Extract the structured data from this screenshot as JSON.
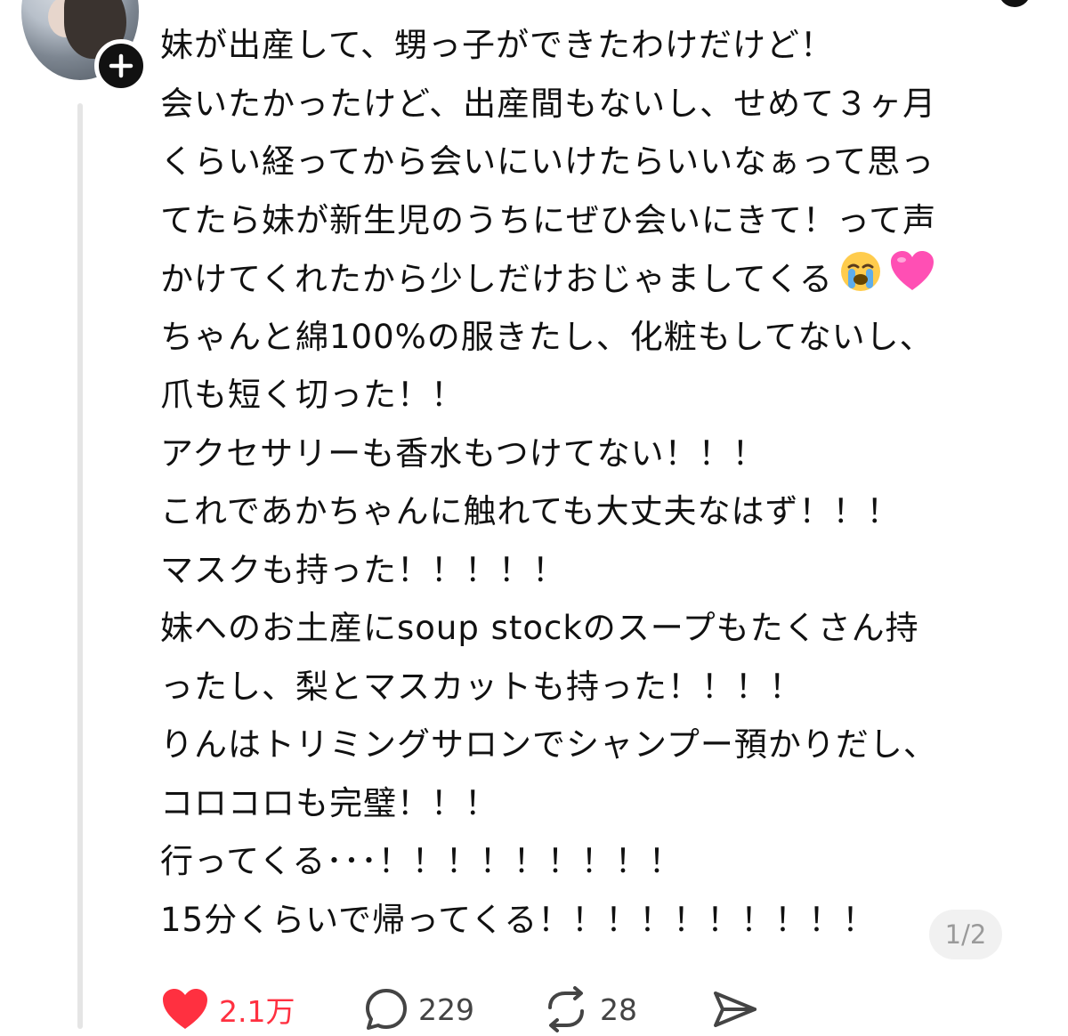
{
  "post": {
    "lines": [
      "妹が出産して、甥っ子ができたわけだけど！",
      "会いたかったけど、出産間もないし、せめて３ヶ月",
      "くらい経ってから会いにいけたらいいなぁって思っ",
      "てたら妹が新生児のうちにぜひ会いにきて！って声",
      "かけてくれたから少しだけおじゃましてくる",
      "ちゃんと綿100%の服きたし、化粧もしてないし、",
      "爪も短く切った！！",
      "アクセサリーも香水もつけてない！！！",
      "これであかちゃんに触れても大丈夫なはず！！！",
      "マスクも持った！！！！！",
      "妹へのお土産にsoup stockのスープもたくさん持",
      "ったし、梨とマスカットも持った！！！！",
      "りんはトリミングサロンでシャンプー預かりだし、",
      "コロコロも完璧！！！",
      "行ってくる･･･！！！！！！！！！",
      "15分くらいで帰ってくる！！！！！！！！！！"
    ],
    "page_indicator": "1/2"
  },
  "actions": {
    "like_count": "2.1万",
    "comment_count": "229",
    "repost_count": "28"
  },
  "icons": {
    "emoji_1": "loudly-crying-face",
    "emoji_2": "pink-heart",
    "like": "heart-icon",
    "comment": "comment-icon",
    "repost": "repost-icon",
    "share": "share-icon"
  },
  "colors": {
    "like": "#ff3040",
    "thread_line": "#e5e5e5",
    "text": "#111111"
  }
}
